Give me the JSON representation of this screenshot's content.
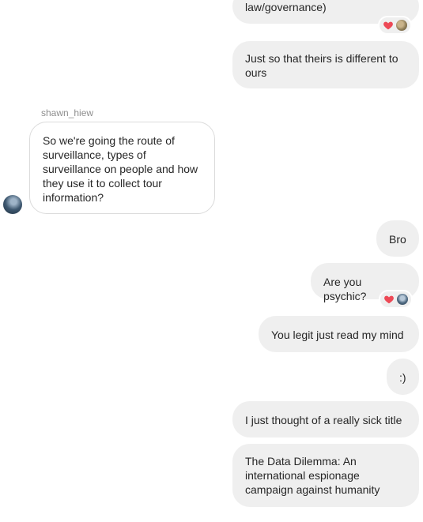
{
  "messages": [
    {
      "id": "m1",
      "direction": "outgoing",
      "text": "law/governance)"
    },
    {
      "id": "m2",
      "direction": "outgoing",
      "text": "Just so that theirs is different to ours"
    },
    {
      "id": "m3",
      "direction": "incoming",
      "sender": "shawn_hiew",
      "text": "So we're going the route of surveillance, types of surveillance on people and how they use it to collect tour information?"
    },
    {
      "id": "m4",
      "direction": "outgoing",
      "text": "Bro"
    },
    {
      "id": "m5",
      "direction": "outgoing",
      "text": "Are you psychic?"
    },
    {
      "id": "m6",
      "direction": "outgoing",
      "text": "You legit just read my mind"
    },
    {
      "id": "m7",
      "direction": "outgoing",
      "text": ":)"
    },
    {
      "id": "m8",
      "direction": "outgoing",
      "text": "I just thought of a really sick title"
    },
    {
      "id": "m9",
      "direction": "outgoing",
      "text": "The Data Dilemma: An international espionage campaign against humanity"
    }
  ],
  "reactions": {
    "m1": [
      "heart-icon",
      "reactor-avatar"
    ],
    "m5": [
      "heart-icon",
      "reactor-avatar"
    ]
  },
  "colors": {
    "bubble_bg": "#efefef",
    "incoming_border": "#dbdbdb",
    "text": "#262626",
    "sender_name": "#8e8e8e",
    "heart": "#ed4956"
  }
}
